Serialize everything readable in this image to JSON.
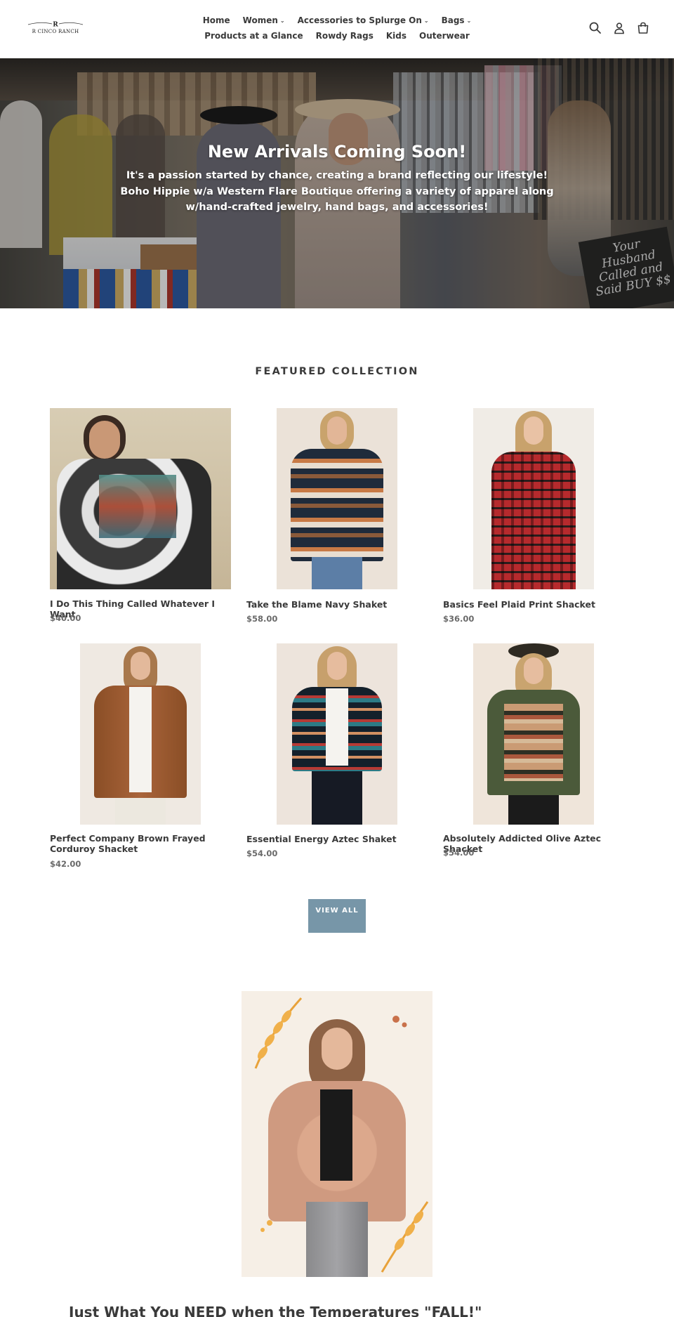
{
  "brand": {
    "logo_text": "R CINCO RANCH"
  },
  "nav": {
    "row1": [
      {
        "label": "Home",
        "dropdown": false
      },
      {
        "label": "Women",
        "dropdown": true
      },
      {
        "label": "Accessories to Splurge On",
        "dropdown": true
      },
      {
        "label": "Bags",
        "dropdown": true
      }
    ],
    "row2": [
      {
        "label": "Products at a Glance",
        "dropdown": false
      },
      {
        "label": "Rowdy Rags",
        "dropdown": false
      },
      {
        "label": "Kids",
        "dropdown": false
      },
      {
        "label": "Outerwear",
        "dropdown": false
      }
    ]
  },
  "header_icons": [
    "search-icon",
    "account-icon",
    "cart-icon"
  ],
  "hero": {
    "title": "New Arrivals Coming Soon!",
    "subtitle": "It's a passion started by chance, creating a brand reflecting our lifestyle! Boho Hippie w/a Western Flare Boutique offering a variety of apparel along w/hand-crafted jewelry, hand bags, and accessories!",
    "sign_text": "Your Husband Called and Said BUY $$"
  },
  "featured": {
    "title": "FEATURED COLLECTION",
    "products": [
      {
        "title": "I Do This Thing Called Whatever I Want",
        "price": "$40.00"
      },
      {
        "title": "Take the Blame Navy Shaket",
        "price": "$58.00"
      },
      {
        "title": "Basics Feel Plaid Print Shacket",
        "price": "$36.00"
      },
      {
        "title": "Perfect Company Brown Frayed Corduroy Shacket",
        "price": "$42.00"
      },
      {
        "title": "Essential Energy Aztec Shaket",
        "price": "$54.00"
      },
      {
        "title": "Absolutely Addicted Olive Aztec Shacket",
        "price": "$54.00"
      }
    ],
    "view_all": "VIEW ALL"
  },
  "bottom": {
    "heading": "Just What You NEED when the Temperatures \"FALL!\""
  },
  "colors": {
    "accent": "#7796a8",
    "text": "#3a3a3a",
    "price": "#6a6a6a"
  }
}
